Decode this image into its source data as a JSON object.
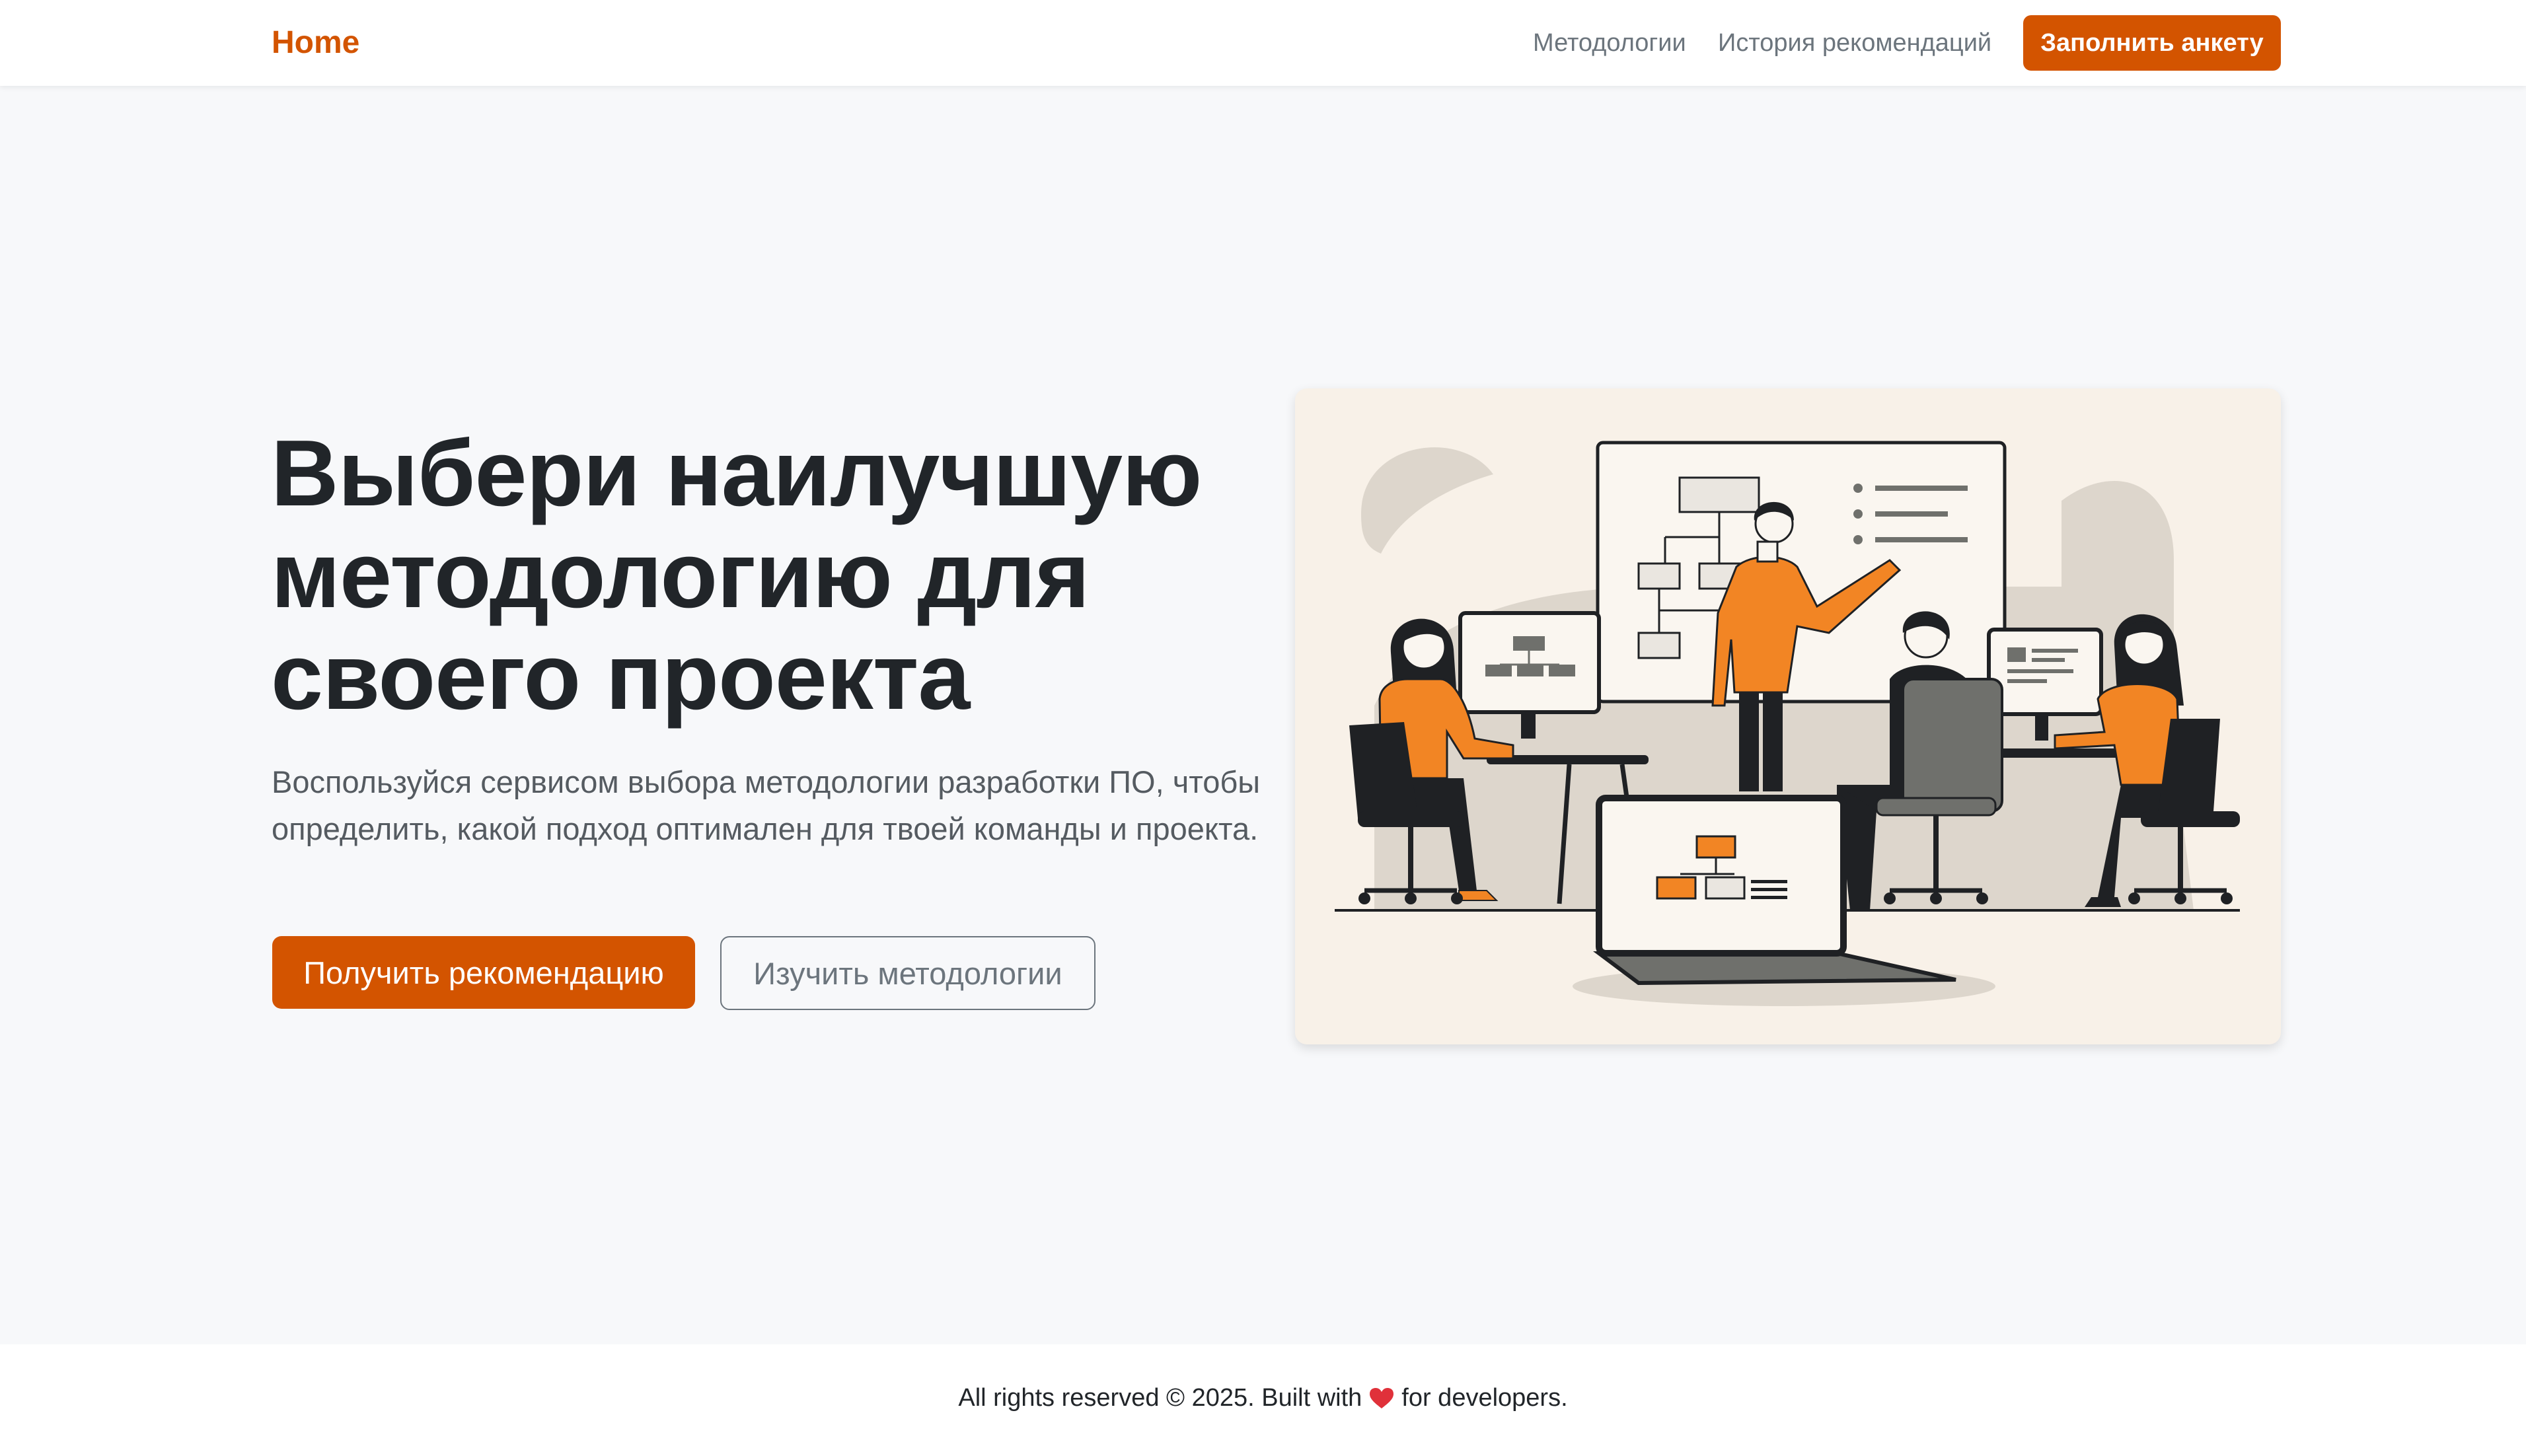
{
  "navbar": {
    "brand": "Home",
    "links": [
      "Методологии",
      "История рекомендаций"
    ],
    "cta": "Заполнить анкету"
  },
  "hero": {
    "title": "Выбери наилучшую методологию для своего проекта",
    "subtitle": "Воспользуйся сервисом выбора методологии разработки ПО, чтобы определить, какой подход оптимален для твоей команды и проекта.",
    "primary_button": "Получить рекомендацию",
    "secondary_button": "Изучить методологии"
  },
  "footer": {
    "text_before": "All rights reserved © 2025. Built with",
    "heart_icon": "heart-icon",
    "text_after": "for developers."
  },
  "colors": {
    "accent": "#d35400",
    "illustration_orange": "#f28524",
    "illustration_dark": "#1f2124",
    "illustration_gray": "#6f706c",
    "illustration_bg": "#f8f1e8"
  }
}
